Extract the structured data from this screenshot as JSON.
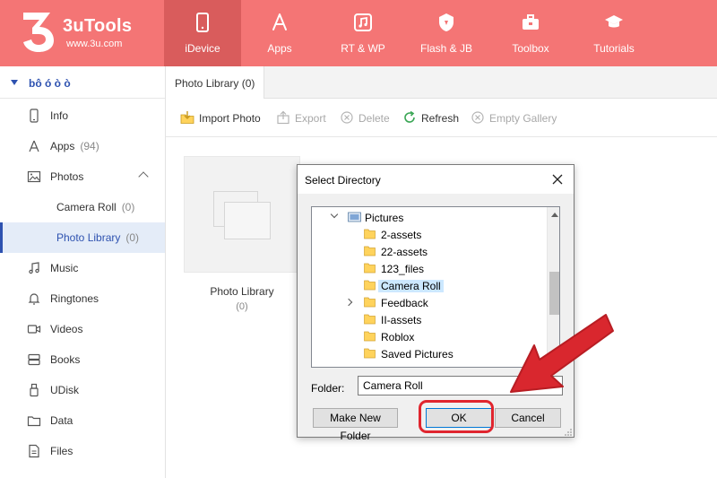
{
  "app": {
    "name": "3uTools",
    "url": "www.3u.com"
  },
  "nav": [
    {
      "label": "iDevice",
      "icon": "phone-icon"
    },
    {
      "label": "Apps",
      "icon": "apps-icon"
    },
    {
      "label": "RT & WP",
      "icon": "music-icon"
    },
    {
      "label": "Flash & JB",
      "icon": "shield-icon"
    },
    {
      "label": "Toolbox",
      "icon": "toolbox-icon"
    },
    {
      "label": "Tutorials",
      "icon": "graduation-cap-icon"
    }
  ],
  "sidebar": {
    "device_name": "bô ó ò ò",
    "items": [
      {
        "label": "Info"
      },
      {
        "label": "Apps",
        "count": "(94)"
      },
      {
        "label": "Photos"
      },
      {
        "label": "Camera Roll",
        "count": "(0)"
      },
      {
        "label": "Photo Library",
        "count": "(0)"
      },
      {
        "label": "Music"
      },
      {
        "label": "Ringtones"
      },
      {
        "label": "Videos"
      },
      {
        "label": "Books"
      },
      {
        "label": "UDisk"
      },
      {
        "label": "Data"
      },
      {
        "label": "Files"
      }
    ]
  },
  "main": {
    "tab": "Photo Library (0)",
    "toolbar": {
      "import": "Import Photo",
      "export": "Export",
      "delete": "Delete",
      "refresh": "Refresh",
      "empty": "Empty Gallery"
    },
    "album": {
      "title": "Photo Library",
      "count": "(0)"
    }
  },
  "dialog": {
    "title": "Select Directory",
    "tree": [
      {
        "label": "Pictures"
      },
      {
        "label": "2-assets"
      },
      {
        "label": "22-assets"
      },
      {
        "label": "123_files"
      },
      {
        "label": "Camera Roll"
      },
      {
        "label": "Feedback"
      },
      {
        "label": "II-assets"
      },
      {
        "label": "Roblox"
      },
      {
        "label": "Saved Pictures"
      }
    ],
    "folder_label": "Folder:",
    "folder_value": "Camera Roll",
    "make_new_folder": "Make New Folder",
    "ok": "OK",
    "cancel": "Cancel"
  },
  "colors": {
    "topbar": "#f47575",
    "nav_active": "#d95c5c",
    "accent": "#2e52b0",
    "annotation": "#e0252e",
    "folder": "#ffd35c"
  }
}
